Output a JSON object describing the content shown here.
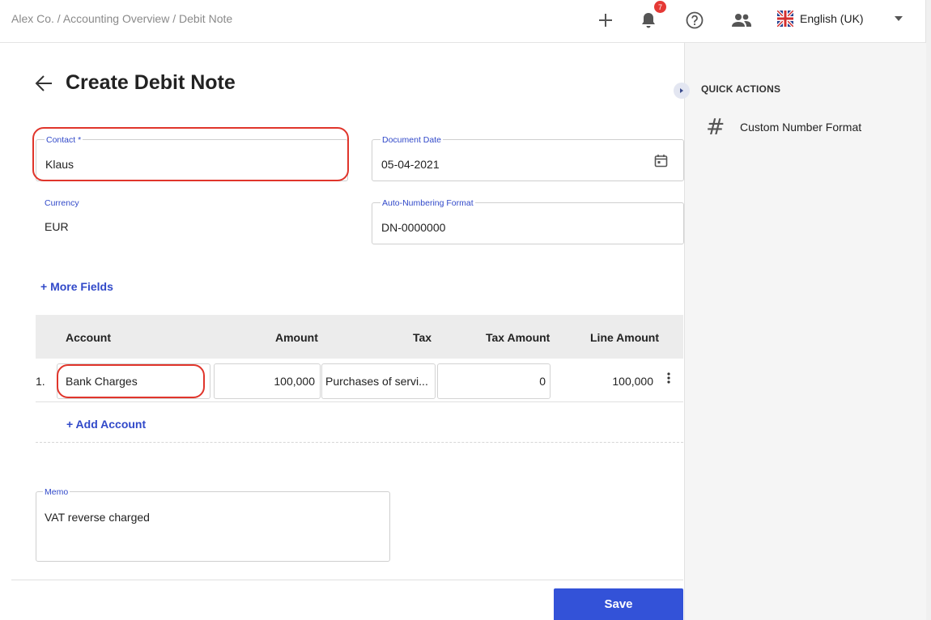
{
  "breadcrumb": [
    "Alex Co.",
    "Accounting Overview",
    "Debit Note"
  ],
  "breadcrumb_sep": " / ",
  "notifications_count": "7",
  "language": "English (UK)",
  "page_title": "Create Debit Note",
  "form": {
    "contact": {
      "label": "Contact *",
      "value": "Klaus"
    },
    "document_date": {
      "label": "Document Date",
      "value": "05-04-2021"
    },
    "currency": {
      "label": "Currency",
      "value": "EUR"
    },
    "auto_numbering": {
      "label": "Auto-Numbering Format",
      "value": "DN-0000000"
    },
    "more_fields": "+ More Fields"
  },
  "table": {
    "headers": {
      "account": "Account",
      "amount": "Amount",
      "tax": "Tax",
      "tax_amount": "Tax Amount",
      "line_amount": "Line Amount"
    },
    "rows": [
      {
        "index": "1.",
        "account": "Bank Charges",
        "amount": "100,000",
        "tax": "Purchases of servi...",
        "tax_amount": "0",
        "line_amount": "100,000"
      }
    ],
    "add_account": "+ Add Account"
  },
  "memo": {
    "label": "Memo",
    "value": "VAT reverse charged"
  },
  "save_label": "Save",
  "quick_actions": {
    "title": "QUICK ACTIONS",
    "items": [
      {
        "icon": "hash-icon",
        "label": "Custom Number Format"
      }
    ]
  },
  "colors": {
    "accent": "#3352d8",
    "highlight": "#e0352b",
    "badge": "#e53935"
  }
}
